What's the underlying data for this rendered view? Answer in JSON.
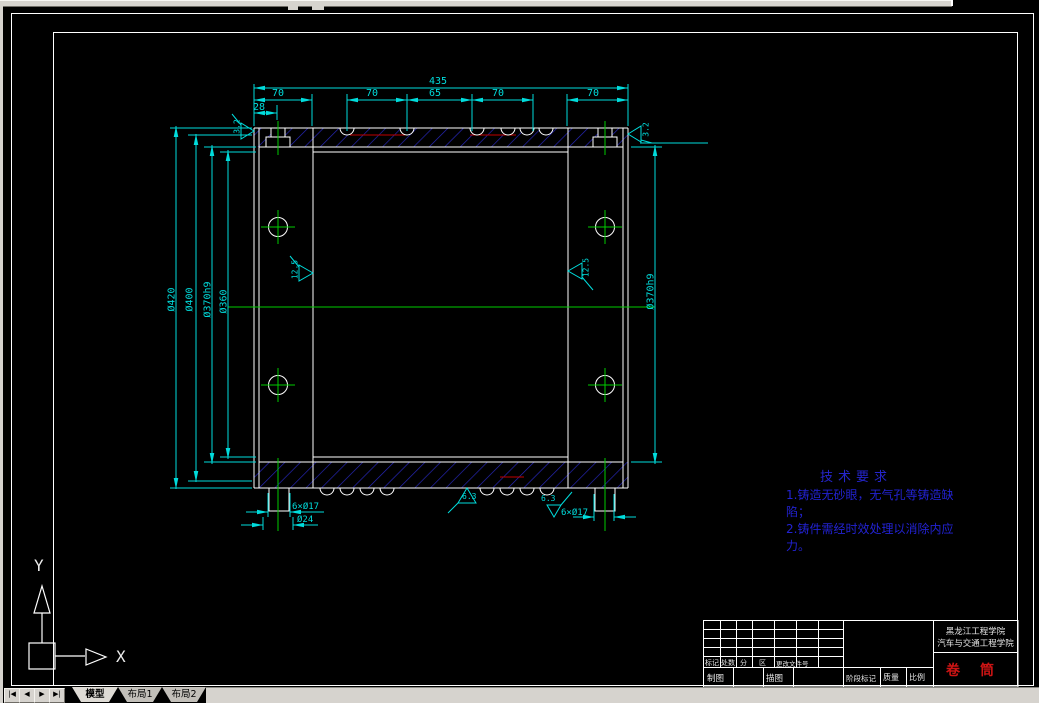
{
  "colors": {
    "canvas_bg": "#000000",
    "line_white": "#ffffff",
    "dim_cyan": "#00dcdc",
    "center_green": "#00cc00",
    "hatch_blue": "#2828c0",
    "rope_red": "#c00000",
    "tech_blue": "#2222d2",
    "title_red": "#cc1414",
    "ui_gray": "#d6d3ce"
  },
  "drawing": {
    "top_dims": [
      "435",
      "70",
      "70",
      "65",
      "70",
      "70",
      "28"
    ],
    "left_dims": [
      "Ø420",
      "Ø400",
      "Ø370h9",
      "Ø360"
    ],
    "right_dim": "Ø370h9",
    "bottom_left_dims": [
      "6×Ø17",
      "Ø24"
    ],
    "bottom_right_dim": "6×Ø17",
    "roughness": {
      "top_left": "3.2",
      "top_right": "3.2",
      "mid_left": "12.5",
      "mid_right": "12.5",
      "bottom_mid": "6.3",
      "bottom_right": "6.3"
    }
  },
  "tech_requirements": {
    "title": "技术要求",
    "lines": [
      "1.铸造无砂眼，无气孔等铸造缺",
      "陷；",
      "2.铸件需经时效处理以消除内应",
      "力。"
    ]
  },
  "title_block": {
    "institution_line1": "黑龙江工程学院",
    "institution_line2": "汽车与交通工程学院",
    "part_name": "卷筒",
    "revision_labels": [
      "标记",
      "处数",
      "分",
      "区",
      "更改文件号"
    ],
    "maker_label": "制图",
    "tracer_label": "描图",
    "stage_label": "阶段标记",
    "mass_label": "质量",
    "scale_label": "比例"
  },
  "ucs": {
    "x_label": "X",
    "y_label": "Y"
  },
  "bottom_bar": {
    "nav": [
      "|◀",
      "◀",
      "▶",
      "▶|"
    ],
    "tabs": [
      {
        "label": "模型"
      },
      {
        "label": "布局1"
      },
      {
        "label": "布局2"
      }
    ]
  }
}
